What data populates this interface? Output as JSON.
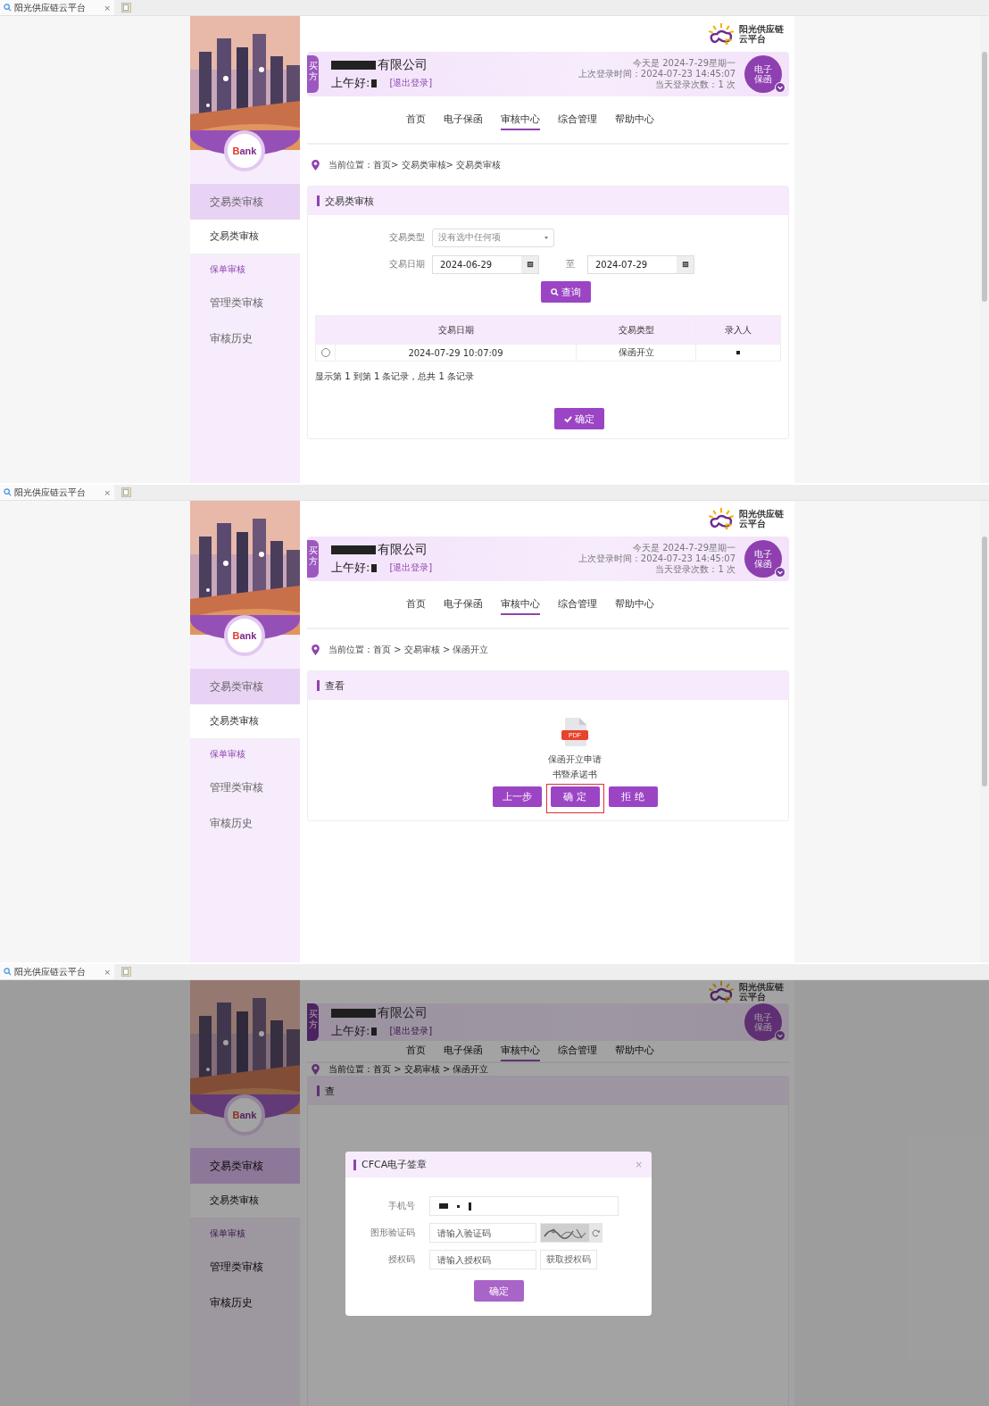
{
  "screens": [
    {
      "kind": "review_list",
      "browser_tab": {
        "title": "阳光供应链云平台",
        "close": "×"
      },
      "logo": {
        "line1": "阳光供应链",
        "line2": "云平台"
      },
      "bank_logo": "Bank",
      "user": {
        "role": "买方",
        "company": "有限公司",
        "greeting": "上午好:",
        "logout": "[退出登录]",
        "today": "今天是 2024-7-29星期一",
        "last_login": "上次登录时间：2024-07-23 14:45:07",
        "login_count": "当天登录次数：1 次",
        "product": "电子保函"
      },
      "nav": [
        {
          "label": "首页",
          "selected": false
        },
        {
          "label": "电子保函",
          "selected": false
        },
        {
          "label": "审核中心",
          "selected": true
        },
        {
          "label": "综合管理",
          "selected": false
        },
        {
          "label": "帮助中心",
          "selected": false
        }
      ],
      "sidebar": [
        {
          "label": "交易类审核",
          "selected": true,
          "children": [
            {
              "label": "交易类审核",
              "selected": true
            },
            {
              "label": "保单审核",
              "selected": false
            }
          ]
        },
        {
          "label": "管理类审核",
          "selected": false
        },
        {
          "label": "审核历史",
          "selected": false
        }
      ],
      "breadcrumb": {
        "label": "当前位置：",
        "path": "首页> 交易类审核> 交易类审核"
      },
      "panel": {
        "title": "交易类审核",
        "type_label": "交易类型",
        "type_placeholder": "没有选中任何项",
        "date_label": "交易日期",
        "date_from": "2024-06-29",
        "date_sep": "至",
        "date_to": "2024-07-29",
        "query_button": "查询",
        "columns": [
          "交易日期",
          "交易类型",
          "录入人"
        ],
        "rows": [
          {
            "selected": false,
            "date": "2024-07-29 10:07:09",
            "type": "保函开立"
          }
        ],
        "summary": "显示第 1 到第 1 条记录，总共 1 条记录",
        "confirm_button": "确定"
      }
    },
    {
      "kind": "review_detail",
      "browser_tab": {
        "title": "阳光供应链云平台",
        "close": "×"
      },
      "logo": {
        "line1": "阳光供应链",
        "line2": "云平台"
      },
      "bank_logo": "Bank",
      "user": {
        "role": "买方",
        "company": "有限公司",
        "greeting": "上午好:",
        "logout": "[退出登录]",
        "today": "今天是 2024-7-29星期一",
        "last_login": "上次登录时间：2024-07-23 14:45:07",
        "login_count": "当天登录次数：1 次",
        "product": "电子保函"
      },
      "nav": [
        {
          "label": "首页",
          "selected": false
        },
        {
          "label": "电子保函",
          "selected": false
        },
        {
          "label": "审核中心",
          "selected": true
        },
        {
          "label": "综合管理",
          "selected": false
        },
        {
          "label": "帮助中心",
          "selected": false
        }
      ],
      "sidebar": [
        {
          "label": "交易类审核",
          "selected": true,
          "children": [
            {
              "label": "交易类审核",
              "selected": true
            },
            {
              "label": "保单审核",
              "selected": false
            }
          ]
        },
        {
          "label": "管理类审核",
          "selected": false
        },
        {
          "label": "审核历史",
          "selected": false
        }
      ],
      "breadcrumb": {
        "label": "当前位置：",
        "path": "首页 > 交易审核 > 保函开立"
      },
      "panel": {
        "title": "查看",
        "document": {
          "badge": "PDF",
          "lines": [
            "保函开立申请",
            "书暨承诺书"
          ]
        },
        "buttons": [
          {
            "label": "上一步",
            "highlighted": false
          },
          {
            "label": "确 定",
            "highlighted": true
          },
          {
            "label": "拒 绝",
            "highlighted": false
          }
        ]
      }
    },
    {
      "kind": "signing_dialog",
      "browser_tab": {
        "title": "阳光供应链云平台",
        "close": "×"
      },
      "logo": {
        "line1": "阳光供应链",
        "line2": "云平台"
      },
      "bank_logo": "Bank",
      "user": {
        "role": "买方",
        "company": "有限公司",
        "greeting": "上午好:",
        "logout": "[退出登录]",
        "product": "电子保函"
      },
      "nav": [
        {
          "label": "首页",
          "selected": false
        },
        {
          "label": "电子保函",
          "selected": false
        },
        {
          "label": "审核中心",
          "selected": true
        },
        {
          "label": "综合管理",
          "selected": false
        },
        {
          "label": "帮助中心",
          "selected": false
        }
      ],
      "sidebar": [
        {
          "label": "交易类审核",
          "selected": true,
          "children": [
            {
              "label": "交易类审核",
              "selected": true
            },
            {
              "label": "保单审核",
              "selected": false
            }
          ]
        },
        {
          "label": "管理类审核",
          "selected": false
        },
        {
          "label": "审核历史",
          "selected": false
        }
      ],
      "breadcrumb": {
        "label": "当前位置：",
        "path": "首页 > 交易审核 > 保函开立"
      },
      "panel": {
        "title": "查"
      },
      "dialog": {
        "title": "CFCA电子签章",
        "close": "×",
        "phone_label": "手机号",
        "captcha_label": "图形验证码",
        "captcha_placeholder": "请输入验证码",
        "code_label": "授权码",
        "code_placeholder": "请输入授权码",
        "code_button": "获取授权码",
        "submit": {
          "label": "确定",
          "disabled": true
        }
      }
    }
  ]
}
